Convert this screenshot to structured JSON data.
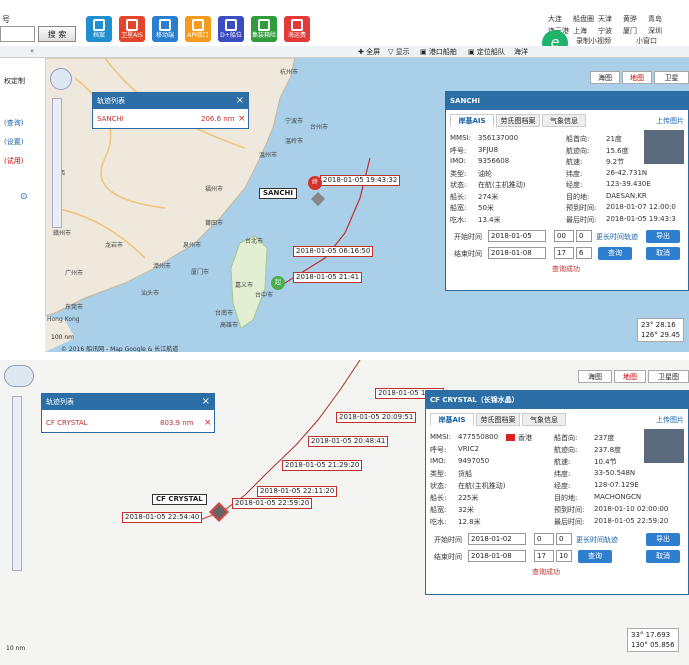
{
  "top": {
    "left_fragment": "号",
    "search_button": "搜 索",
    "tools": [
      {
        "label": "档案",
        "color": "#1f8fcf",
        "icon": "archive-icon"
      },
      {
        "label": "卫星AIS",
        "color": "#e2452b",
        "icon": "satellite-icon"
      },
      {
        "label": "移动端",
        "color": "#2a7ed0",
        "icon": "mobile-icon"
      },
      {
        "label": "API接口",
        "color": "#f29b1e",
        "icon": "api-icon"
      },
      {
        "label": "D+船位",
        "color": "#3b4cc0",
        "icon": "plane-icon"
      },
      {
        "label": "集装箱险",
        "color": "#2f9b3a",
        "icon": "shield-icon"
      },
      {
        "label": "海运费",
        "color": "#e23a3a",
        "icon": "chat-icon"
      }
    ],
    "cities": [
      [
        "大连",
        "船盘圈",
        "天津",
        "黄骅",
        "青岛"
      ],
      [
        "连云港",
        "上海",
        "宁波",
        "厦门",
        "深圳"
      ]
    ],
    "side_buttons": [
      "录制小视频",
      "小窗口"
    ]
  },
  "mapbar": {
    "collapse": "«",
    "items": [
      "全屏",
      "显示",
      "港口船舶",
      "定位船队",
      "海洋"
    ]
  },
  "left_side": {
    "items": [
      "权定制",
      "(查询)",
      "(设置)",
      "(试用)"
    ]
  },
  "panel1": {
    "map_types": [
      "海图",
      "地图",
      "卫星"
    ],
    "track_list": {
      "title": "轨迹列表",
      "ship": "SANCHI",
      "distance": "206.6 nm",
      "close": "×"
    },
    "ship_label": "SANCHI",
    "track_labels": [
      "2018-01-05 19:43:32",
      "2018-01-05 06:16:50",
      "2018-01-05 21:41"
    ],
    "cities": [
      "杭州市",
      "宁波市",
      "温州市",
      "福州市",
      "泉州市",
      "漳州市",
      "厦门市",
      "广州市",
      "东莞市",
      "台北市",
      "台中市",
      "台南市",
      "高雄市",
      "嘉义市",
      "Hong Kong",
      "汕头市",
      "金华市",
      "龙岩市",
      "丽水市",
      "台州市",
      "莆田市",
      "温岭市",
      "衢州市",
      "赣州市",
      "江西"
    ],
    "scale": "100 nm",
    "copyright": "© 2016 船讯网 - Map Google & 长江航道",
    "coord": [
      "23° 28.16",
      "126° 29.45"
    ],
    "info": {
      "title": "SANCHI",
      "tabs": [
        "岸基AIS",
        "劳氏图档案",
        "气象信息"
      ],
      "link": "上传图片",
      "left": [
        [
          "MMSI:",
          "356137000"
        ],
        [
          "呼号:",
          "3FJU8"
        ],
        [
          "IMO:",
          "9356608"
        ],
        [
          "类型:",
          "油轮"
        ],
        [
          "状态:",
          "在航(主机推动)"
        ],
        [
          "船长:",
          "274米"
        ],
        [
          "船宽:",
          "50米"
        ],
        [
          "吃水:",
          "13.4米"
        ]
      ],
      "right": [
        [
          "船首向:",
          "21度"
        ],
        [
          "航迹向:",
          "15.6度"
        ],
        [
          "航速:",
          "9.2节"
        ],
        [
          "纬度:",
          "26-42.731N"
        ],
        [
          "经度:",
          "123-39.430E"
        ],
        [
          "目的地:",
          "DAESAN,KR"
        ],
        [
          "预到时间:",
          "2018-01-07 12:00:0"
        ],
        [
          "最后时间:",
          "2018-01-05 19:43:3"
        ]
      ],
      "start_label": "开始时间",
      "start_date": "2018-01-05",
      "start_hour": "00",
      "start_min": "0",
      "end_label": "结束时间",
      "end_date": "2018-01-08",
      "end_hour": "17",
      "end_min": "6",
      "more_link": "更长时间轨迹",
      "export": "导出",
      "query": "查询",
      "cancel": "取消",
      "success": "查询成功"
    }
  },
  "panel2": {
    "map_types": [
      "海图",
      "地图",
      "卫星图"
    ],
    "track_list": {
      "title": "轨迹列表",
      "ship": "CF CRYSTAL",
      "distance": "803.9 nm",
      "close": "×"
    },
    "ship_label": "CF CRYSTAL",
    "track_labels": [
      "2018-01-05 19:33",
      "2018-01-05 20:09:51",
      "2018-01-05 20:48:41",
      "2018-01-05 21:29:20",
      "2018-01-05 22:11:20",
      "2018-01-05 22:59:20",
      "2018-01-05 22:54:40"
    ],
    "scale": "10 nm",
    "coord": [
      "33° 17.693",
      "130° 05.856"
    ],
    "info": {
      "title": "CF CRYSTAL（长锦水晶）",
      "tabs": [
        "岸基AIS",
        "劳氏图档案",
        "气象信息"
      ],
      "link": "上传图片",
      "left": [
        [
          "MMSI:",
          "477550800"
        ],
        [
          "呼号:",
          "VRIC2"
        ],
        [
          "IMO:",
          "9497050"
        ],
        [
          "类型:",
          "货船"
        ],
        [
          "状态:",
          "在航(主机推动)"
        ],
        [
          "船长:",
          "225米"
        ],
        [
          "船宽:",
          "32米"
        ],
        [
          "吃水:",
          "12.8米"
        ]
      ],
      "flag_text": "香港",
      "right": [
        [
          "船首向:",
          "237度"
        ],
        [
          "航迹向:",
          "237.8度"
        ],
        [
          "航速:",
          "10.4节"
        ],
        [
          "纬度:",
          "33-50.548N"
        ],
        [
          "经度:",
          "128-07.129E"
        ],
        [
          "目的地:",
          "MACHONGCN"
        ],
        [
          "预到时间:",
          "2018-01-10 02:00:00"
        ],
        [
          "最后时间:",
          "2018-01-05 22:59:20"
        ]
      ],
      "start_label": "开始时间",
      "start_date": "2018-01-02",
      "start_hour": "0",
      "start_min": "0",
      "end_label": "结束时间",
      "end_date": "2018-01-08",
      "end_hour": "17",
      "end_min": "10",
      "more_link": "更长时间轨迹",
      "export": "导出",
      "query": "查询",
      "cancel": "取消",
      "success": "查询成功"
    }
  }
}
